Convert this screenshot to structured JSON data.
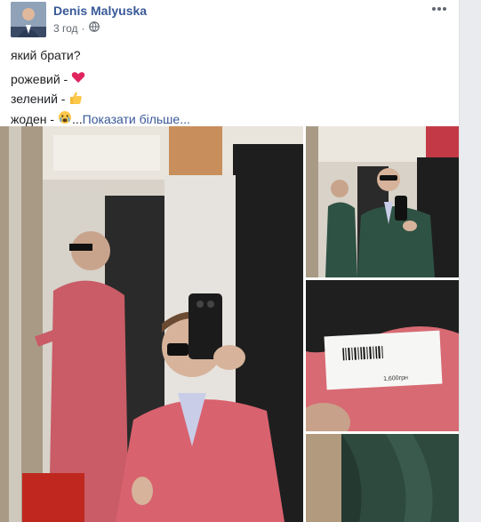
{
  "post": {
    "author": "Denis Malyuska",
    "time": "3 год",
    "separator": "·",
    "privacy_icon": "globe-icon",
    "menu_icon": "more-options-icon",
    "text_lines": [
      {
        "text": "який брати?",
        "emoji": ""
      },
      {
        "text": "рожевий - ",
        "emoji": "heart-icon"
      },
      {
        "text": "зелений - ",
        "emoji": "thumbs-up-icon"
      },
      {
        "text": "жоден - ",
        "emoji": "crying-face-icon"
      }
    ],
    "ellipsis": "...",
    "see_more": "Показати більше..."
  },
  "colors": {
    "author_link": "#385898",
    "meta": "#606770",
    "pink_suit": "#d9626f",
    "green_suit": "#2e5244"
  },
  "photos": [
    {
      "name": "main-photo",
      "description": "man in pink suit taking mirror selfie"
    },
    {
      "name": "green-suit-photo",
      "description": "man in green suit taking mirror selfie"
    },
    {
      "name": "price-tag-photo",
      "description": "price tag closeup",
      "tag_text": "1,600грн"
    },
    {
      "name": "fabric-photo",
      "description": "green fabric closeup"
    }
  ]
}
